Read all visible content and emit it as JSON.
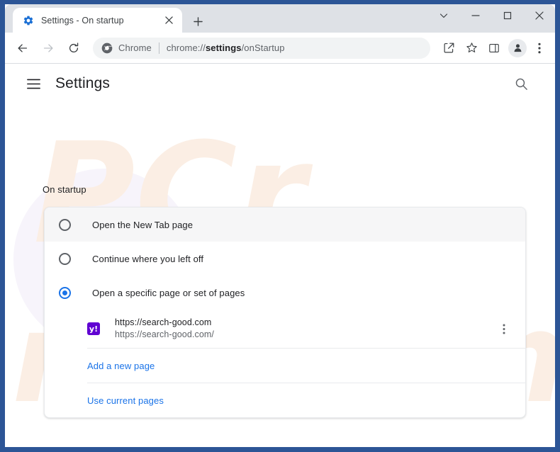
{
  "window": {
    "controls": {
      "tab_search": "tab-search-chevron",
      "minimize": "minimize",
      "maximize": "maximize",
      "close": "close"
    }
  },
  "tabstrip": {
    "tabs": [
      {
        "title": "Settings - On startup",
        "favicon": "settings-gear-icon",
        "close_label": "Close tab"
      }
    ],
    "new_tab_label": "New tab"
  },
  "toolbar": {
    "back_label": "Back",
    "forward_label": "Forward",
    "reload_label": "Reload",
    "omnibox": {
      "chip_label": "Chrome",
      "url_prefix": "chrome://",
      "url_bold": "settings",
      "url_suffix": "/onStartup",
      "full_url": "chrome://settings/onStartup"
    },
    "share_label": "Share this page",
    "bookmark_label": "Bookmark this tab",
    "side_panel_label": "Side panel",
    "profile_label": "Profile",
    "menu_label": "Customize and control Google Chrome"
  },
  "settings": {
    "menu_label": "Main menu",
    "title": "Settings",
    "search_label": "Search settings",
    "section_title": "On startup",
    "options": [
      {
        "label": "Open the New Tab page",
        "selected": false,
        "highlighted": true
      },
      {
        "label": "Continue where you left off",
        "selected": false,
        "highlighted": false
      },
      {
        "label": "Open a specific page or set of pages",
        "selected": true,
        "highlighted": false
      }
    ],
    "startup_pages": [
      {
        "title": "https://search-good.com",
        "url": "https://search-good.com/",
        "favicon_text": "y!",
        "favicon_color": "#6001d2",
        "menu_label": "More actions"
      }
    ],
    "add_page_label": "Add a new page",
    "use_current_label": "Use current pages"
  },
  "watermark": {
    "text_top": "PCr",
    "text_bottom": "risk.com",
    "full": "pcrisk.com"
  },
  "colors": {
    "accent": "#1a73e8",
    "window_frame": "#2c5596",
    "tabstrip": "#dee1e6",
    "text_primary": "#202124",
    "text_secondary": "#5f6368",
    "watermark": "#fbeee4"
  }
}
